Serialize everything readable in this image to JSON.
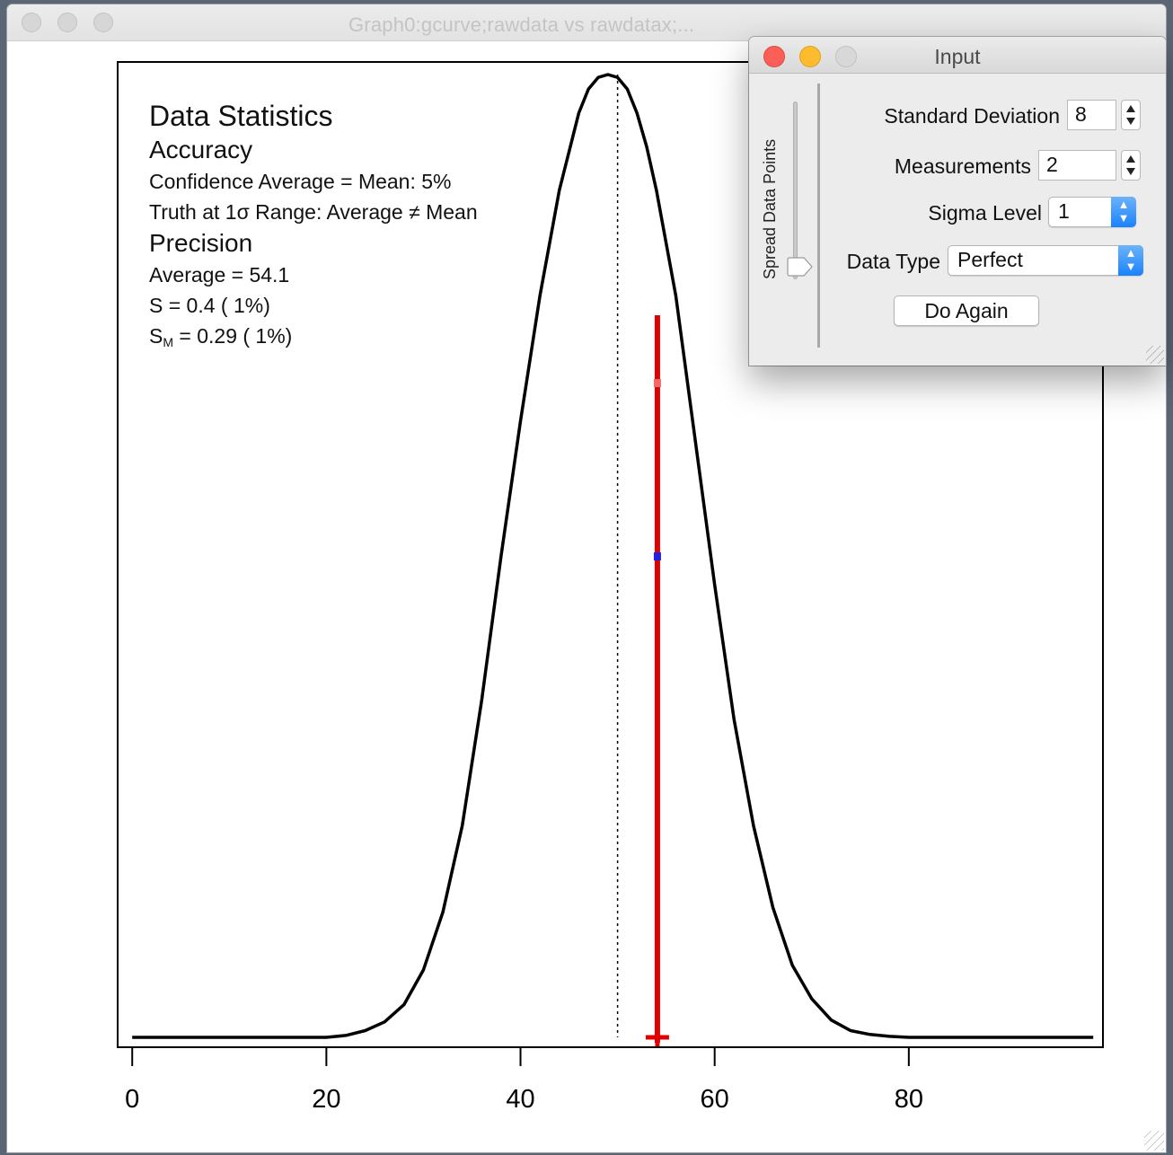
{
  "main_window": {
    "title": "Graph0:gcurve;rawdata vs rawdatax;..."
  },
  "stats": {
    "heading": "Data Statistics",
    "accuracy_heading": "Accuracy",
    "confidence_line": "Confidence Average = Mean: 5%",
    "truth_line": "Truth at 1σ Range: Average ≠ Mean",
    "precision_heading": "Precision",
    "average_line": "Average = 54.1",
    "s_line": "S = 0.4 ( 1%)",
    "sm_prefix": "S",
    "sm_sub": "M",
    "sm_rest": " = 0.29 ( 1%)"
  },
  "input_window": {
    "title": "Input",
    "spread_label": "Spread Data Points",
    "std_dev_label": "Standard Deviation",
    "std_dev_value": "8",
    "measurements_label": "Measurements",
    "measurements_value": "2",
    "sigma_label": "Sigma Level",
    "sigma_value": "1",
    "data_type_label": "Data Type",
    "data_type_value": "Perfect",
    "do_again_label": "Do Again"
  },
  "chart_data": {
    "type": "line",
    "xlim": [
      -1.5,
      100
    ],
    "ylim": [
      0,
      1.0
    ],
    "x_ticks": [
      0,
      20,
      40,
      60,
      80
    ],
    "x_tick_labels": [
      "0",
      "20",
      "40",
      "60",
      "80"
    ],
    "series": [
      {
        "x": [
          0,
          5,
          10,
          15,
          20,
          22,
          24,
          26,
          28,
          30,
          32,
          34,
          36,
          38,
          40,
          42,
          44,
          46,
          47,
          48,
          49,
          50,
          51,
          52,
          53,
          54,
          56,
          58,
          60,
          62,
          64,
          66,
          68,
          70,
          72,
          74,
          76,
          78,
          80,
          85,
          90,
          95,
          99
        ],
        "y": [
          0,
          0,
          0,
          0,
          0,
          0.002,
          0.007,
          0.016,
          0.034,
          0.07,
          0.13,
          0.22,
          0.35,
          0.5,
          0.64,
          0.77,
          0.88,
          0.96,
          0.985,
          0.997,
          1.0,
          0.997,
          0.985,
          0.96,
          0.925,
          0.88,
          0.77,
          0.62,
          0.47,
          0.33,
          0.22,
          0.135,
          0.075,
          0.04,
          0.018,
          0.007,
          0.003,
          0.001,
          0,
          0,
          0,
          0,
          0
        ]
      }
    ],
    "mean_line_x": 50,
    "measurement": {
      "x": 54.1,
      "bar_top": 0.75,
      "red_point": 0.68,
      "blue_point": 0.5
    },
    "colors": {
      "curve": "#000000",
      "measurement": "#e00000",
      "blue_point": "#2020dd"
    }
  }
}
